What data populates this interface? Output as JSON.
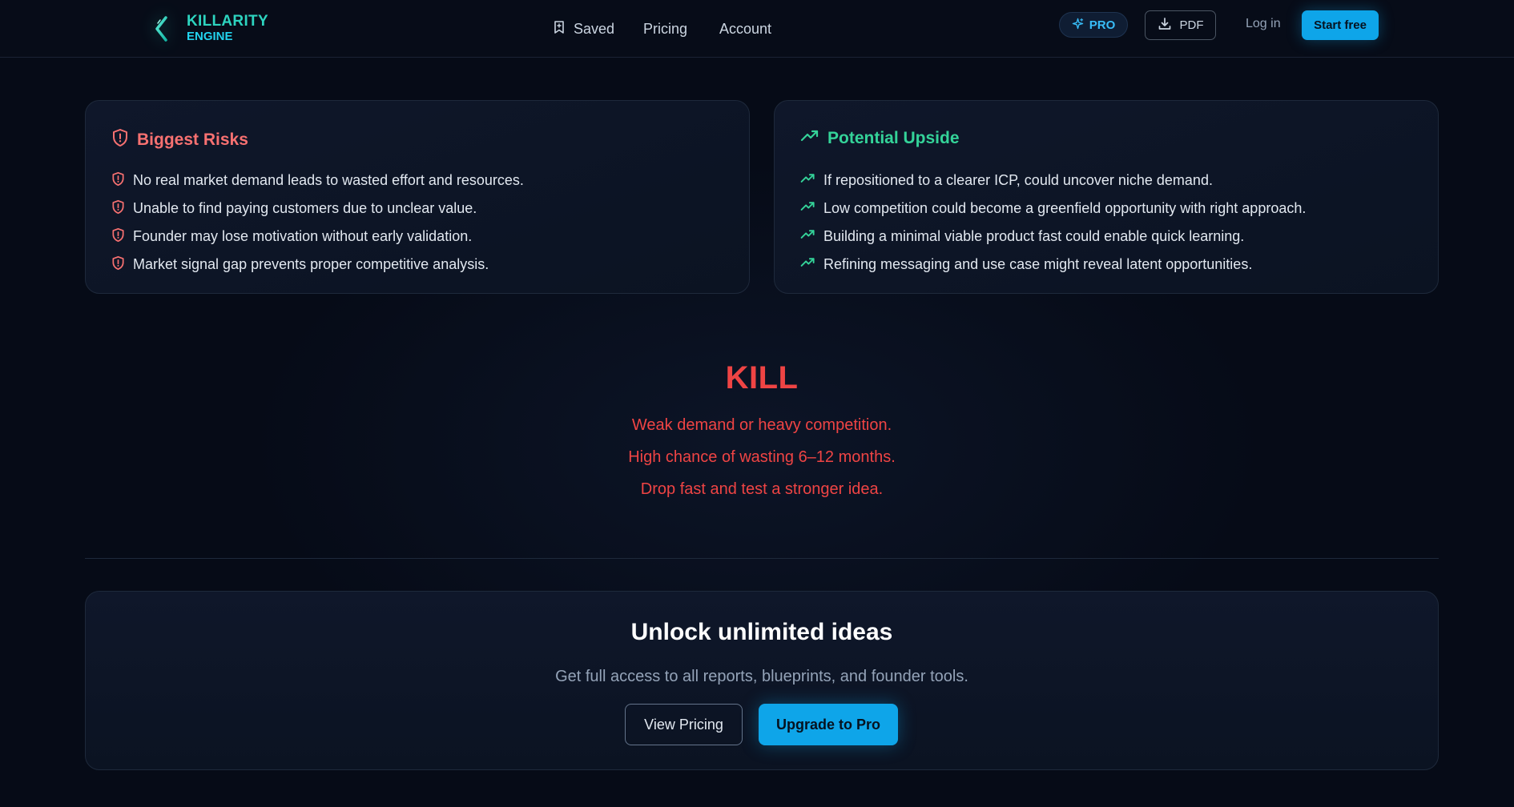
{
  "brand": {
    "line1": "KILLARITY",
    "line2": "ENGINE",
    "icon": "killarity-k-logo"
  },
  "nav": {
    "saved": "Saved",
    "pricing": "Pricing",
    "account": "Account"
  },
  "header_actions": {
    "pro": "PRO",
    "pdf": "PDF",
    "login": "Log in",
    "start": "Start free"
  },
  "risks": {
    "title": "Biggest Risks",
    "icon": "shield-alert-icon",
    "items": [
      "No real market demand leads to wasted effort and resources.",
      "Unable to find paying customers due to unclear value.",
      "Founder may lose motivation without early validation.",
      "Market signal gap prevents proper competitive analysis."
    ]
  },
  "upside": {
    "title": "Potential Upside",
    "icon": "trending-up-icon",
    "items": [
      "If repositioned to a clearer ICP, could uncover niche demand.",
      "Low competition could become a greenfield opportunity with right approach.",
      "Building a minimal viable product fast could enable quick learning.",
      "Refining messaging and use case might reveal latent opportunities."
    ]
  },
  "verdict": {
    "word": "KILL",
    "lines": [
      "Weak demand or heavy competition.",
      "High chance of wasting 6–12 months.",
      "Drop fast and test a stronger idea."
    ]
  },
  "upgrade": {
    "title": "Unlock unlimited ideas",
    "subtitle": "Get full access to all reports, blueprints, and founder tools.",
    "view_pricing": "View Pricing",
    "upgrade_cta": "Upgrade to Pro"
  },
  "colors": {
    "background": "#060b17",
    "accent": "#0ea5e9",
    "risk": "#f87171",
    "upside": "#34d399",
    "verdict": "#ef4444",
    "brand": "#2dd4bf"
  }
}
